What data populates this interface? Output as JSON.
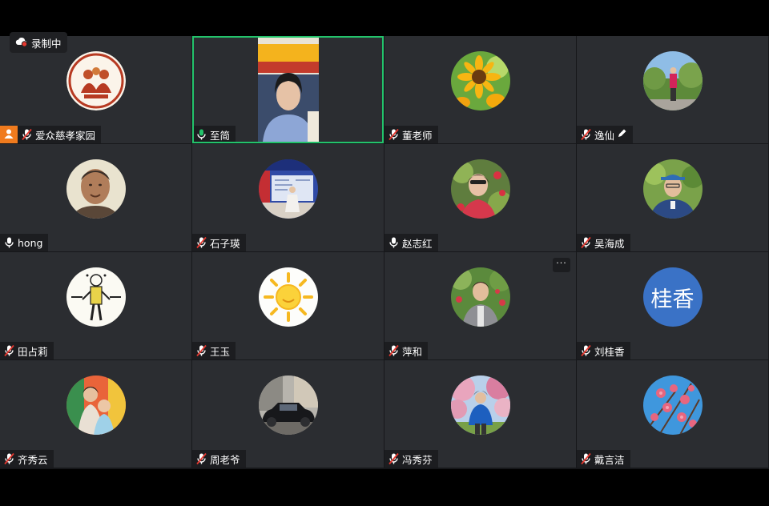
{
  "recording": {
    "label": "录制中",
    "icon": "cloud-record-icon"
  },
  "colors": {
    "tile_bg": "#2b2d31",
    "active_border": "#23c36b",
    "host_badge": "#f07b1e",
    "avatar_text_bg": "#3a72c6"
  },
  "participants": [
    {
      "name": "爱众慈孝家园",
      "mic": "muted",
      "avatar": "logo",
      "host": true
    },
    {
      "name": "至简",
      "mic": "active",
      "avatar": "video",
      "speaking": true
    },
    {
      "name": "董老师",
      "mic": "muted",
      "avatar": "sunflower"
    },
    {
      "name": "逸仙",
      "mic": "muted",
      "avatar": "garden",
      "editing": true
    },
    {
      "name": "hong",
      "mic": "on",
      "avatar": "man"
    },
    {
      "name": "石子瑛",
      "mic": "muted",
      "avatar": "stage"
    },
    {
      "name": "赵志红",
      "mic": "on",
      "avatar": "flowers-woman"
    },
    {
      "name": "吴海成",
      "mic": "muted",
      "avatar": "man-cap"
    },
    {
      "name": "田占莉",
      "mic": "muted",
      "avatar": "drawing"
    },
    {
      "name": "王玉",
      "mic": "muted",
      "avatar": "sun"
    },
    {
      "name": "萍和",
      "mic": "muted",
      "avatar": "woman-garden",
      "more": "···"
    },
    {
      "name": "刘桂香",
      "mic": "muted",
      "avatar": "text",
      "avatar_text": "桂香"
    },
    {
      "name": "齐秀云",
      "mic": "muted",
      "avatar": "kids"
    },
    {
      "name": "周老爷",
      "mic": "muted",
      "avatar": "car"
    },
    {
      "name": "冯秀芬",
      "mic": "muted",
      "avatar": "blossom-woman"
    },
    {
      "name": "戴言洁",
      "mic": "muted",
      "avatar": "blossoms"
    }
  ]
}
